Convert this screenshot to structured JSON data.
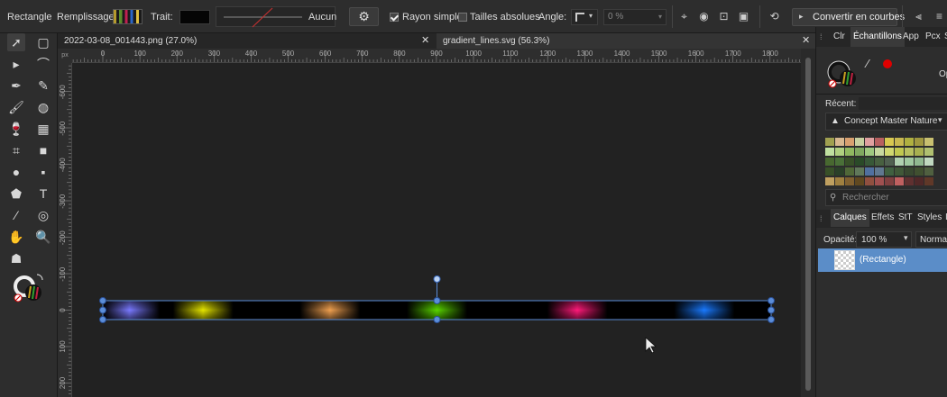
{
  "context_toolbar": {
    "tool_name": "Rectangle",
    "fill_label": "Remplissage:",
    "stroke_label": "Trait:",
    "stroke_value": "Aucun",
    "simple_radius_label": "Rayon simple",
    "simple_radius_checked": true,
    "absolute_sizes_label": "Tailles absolues",
    "absolute_sizes_checked": false,
    "angle_label": "Angle:",
    "angle_value": "0 %",
    "convert_label": "Convertir en courbes"
  },
  "document_tabs": [
    {
      "label": "2022-03-08_001443.png (27.0%)",
      "active": false
    },
    {
      "label": "gradient_lines.svg (56.3%)",
      "active": true
    }
  ],
  "ruler": {
    "unit": "px",
    "h_labels": [
      "0",
      "100",
      "200",
      "300",
      "400",
      "500",
      "600",
      "700",
      "800",
      "900",
      "1000",
      "1100",
      "1200",
      "1300",
      "1400",
      "1500",
      "1600",
      "1700",
      "1800"
    ],
    "v_labels": [
      "-600",
      "-500",
      "-400",
      "-300",
      "-200",
      "-100",
      "0",
      "100",
      "200"
    ]
  },
  "canvas": {
    "shape": "rectangle",
    "background": "#000000",
    "gradient_stops": [
      {
        "color": "#7a7aff",
        "label": "violet"
      },
      {
        "color": "#e6e600",
        "label": "yellow"
      },
      {
        "color": "#f0a050",
        "label": "orange"
      },
      {
        "color": "#5ad600",
        "label": "green"
      },
      {
        "color": "#ff1a7a",
        "label": "magenta"
      },
      {
        "color": "#1a7aff",
        "label": "blue"
      }
    ],
    "selection_color": "#5b8dd9"
  },
  "right_panel": {
    "tabs": [
      "Clr",
      "Échantillons",
      "App",
      "Pcx",
      "S"
    ],
    "active_tab": "Échantillons",
    "opacity_short": "Op",
    "recent_label": "Récent:",
    "palette_name": "Concept Master Nature",
    "search_placeholder": "Rechercher",
    "layers_tabs": [
      "Calques",
      "Effets",
      "StT",
      "Styles",
      "I"
    ],
    "active_layers_tab": "Calques",
    "opacity_label": "Opacité:",
    "opacity_value": "100 %",
    "blend_mode": "Normal",
    "layer_name": "(Rectangle)"
  },
  "palette_rows": [
    [
      "#a0a050",
      "#d8b890",
      "#d8a070",
      "#c8d0a0",
      "#e0a0a0",
      "#b86060",
      "#d8c850",
      "#c8b850",
      "#b0b040",
      "#a09840",
      "#c8c070"
    ],
    [
      "#c0e0a0",
      "#b0d080",
      "#90b860",
      "#80a860",
      "#a0c880",
      "#c8d8a0",
      "#d0d870",
      "#c0c850",
      "#b8c060",
      "#a8b050",
      "#b0c070"
    ],
    [
      "#486830",
      "#4a7038",
      "#385028",
      "#2a4a28",
      "#385838",
      "#486040",
      "#506050",
      "#b0d0b0",
      "#a0c8a0",
      "#90b890",
      "#c0d8c0"
    ],
    [
      "#385028",
      "#2a4028",
      "#506838",
      "#60785a",
      "#5070a0",
      "#607890",
      "#406040",
      "#405838",
      "#384830",
      "#405030",
      "#506040"
    ],
    [
      "#c0a060",
      "#a08040",
      "#806030",
      "#604820",
      "#905040",
      "#a05050",
      "#804040",
      "#c06060",
      "#603030",
      "#502828",
      "#603828"
    ]
  ]
}
